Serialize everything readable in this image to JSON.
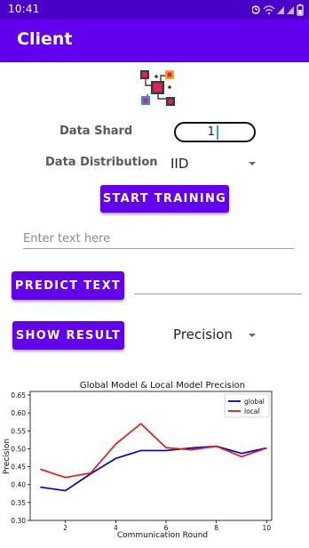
{
  "status_bar": {
    "time": "10:41",
    "icons": [
      "alarm-icon",
      "wifi-icon",
      "signal-icon",
      "signal-icon",
      "battery-icon"
    ]
  },
  "app_bar": {
    "title": "Client"
  },
  "form": {
    "data_shard_label": "Data Shard",
    "data_shard_value": "1",
    "data_distribution_label": "Data Distribution",
    "data_distribution_value": "IID",
    "start_button": "START TRAINING",
    "text_placeholder": "Enter text here",
    "predict_button": "PREDICT TEXT",
    "show_result_button": "SHOW RESULT",
    "metric_value": "Precision"
  },
  "colors": {
    "primary": "#6200ee",
    "primary_dark": "#4b00c8",
    "global": "#0000cc",
    "local": "#e31a1c"
  },
  "chart_data": {
    "type": "line",
    "title": "Global Model & Local Model Precision",
    "xlabel": "Communication Round",
    "ylabel": "Precision",
    "xlim": [
      0.6,
      10.2
    ],
    "ylim": [
      0.3,
      0.66
    ],
    "xticks": [
      2,
      4,
      6,
      8,
      10
    ],
    "yticks": [
      0.3,
      0.35,
      0.4,
      0.45,
      0.5,
      0.55,
      0.6,
      0.65
    ],
    "grid": false,
    "legend": "top-right",
    "x": [
      1,
      2,
      3,
      4,
      5,
      6,
      7,
      8,
      9,
      10
    ],
    "series": [
      {
        "name": "global",
        "color": "#0000cc",
        "values": [
          0.393,
          0.383,
          0.43,
          0.473,
          0.495,
          0.495,
          0.502,
          0.507,
          0.487,
          0.502
        ]
      },
      {
        "name": "local",
        "color": "#e31a1c",
        "values": [
          0.443,
          0.42,
          0.432,
          0.513,
          0.57,
          0.503,
          0.497,
          0.507,
          0.478,
          0.502
        ]
      }
    ]
  }
}
